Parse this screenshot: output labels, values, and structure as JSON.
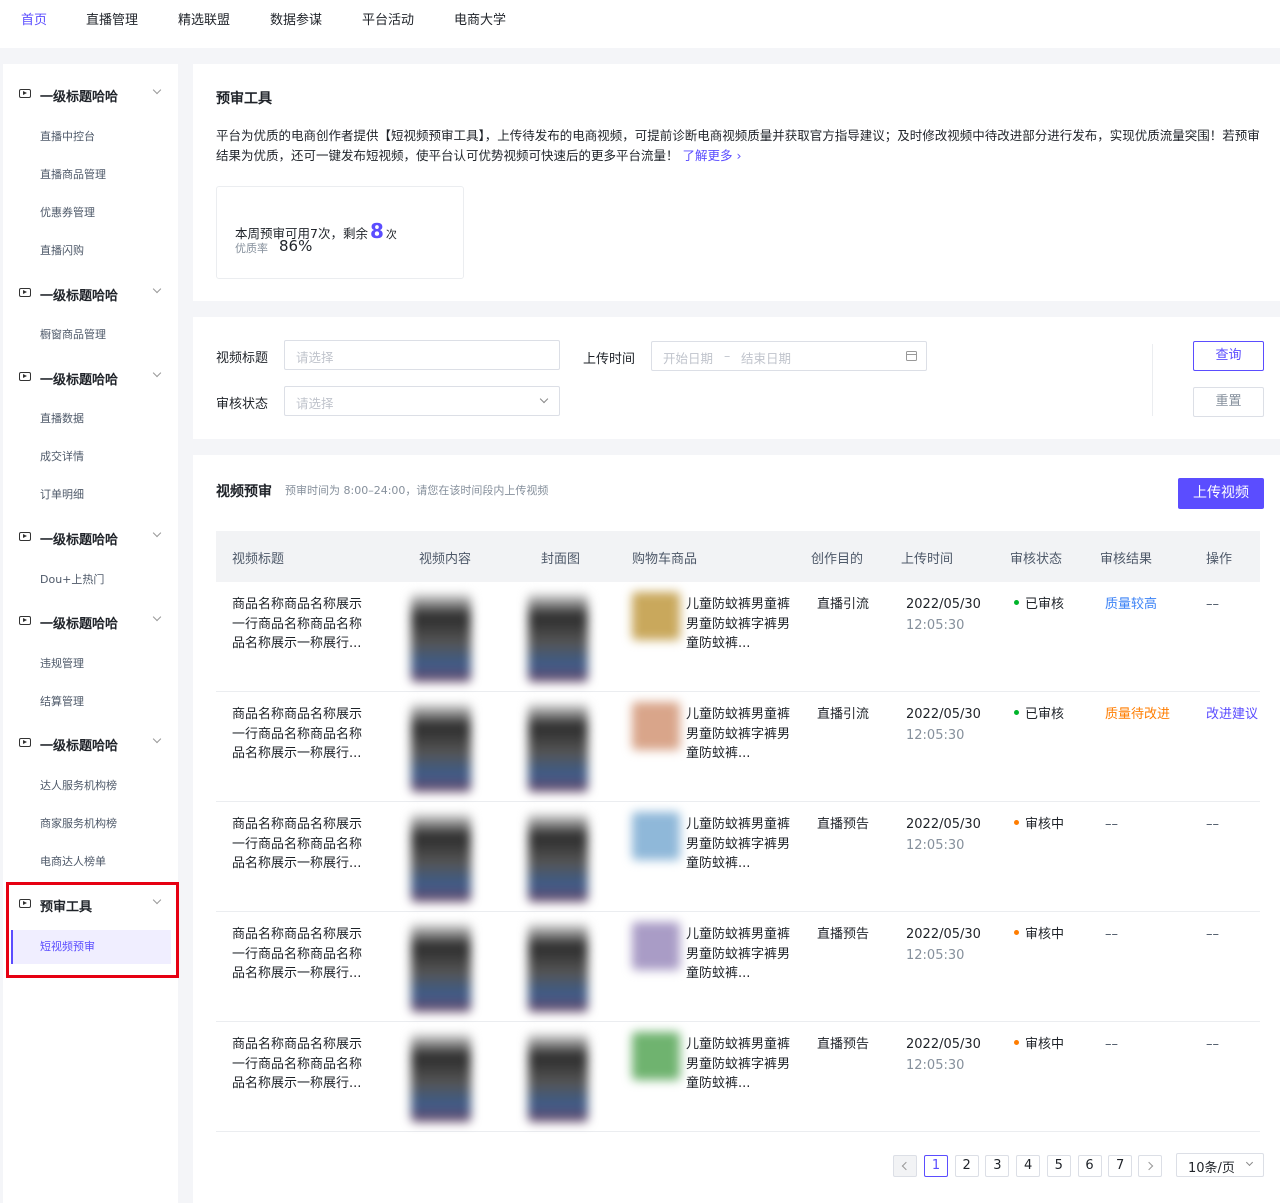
{
  "topnav": {
    "items": [
      "首页",
      "直播管理",
      "精选联盟",
      "数据参谋",
      "平台活动",
      "电商大学"
    ],
    "active_index": 0
  },
  "sidebar": {
    "groups": [
      {
        "label": "一级标题哈哈",
        "items": [
          "直播中控台",
          "直播商品管理",
          "优惠券管理",
          "直播闪购"
        ]
      },
      {
        "label": "一级标题哈哈",
        "items": [
          "橱窗商品管理"
        ]
      },
      {
        "label": "一级标题哈哈",
        "items": [
          "直播数据",
          "成交详情",
          "订单明细"
        ]
      },
      {
        "label": "一级标题哈哈",
        "items": [
          "Dou+上热门"
        ]
      },
      {
        "label": "一级标题哈哈",
        "items": [
          "违规管理",
          "结算管理"
        ]
      },
      {
        "label": "一级标题哈哈",
        "items": [
          "达人服务机构榜",
          "商家服务机构榜",
          "电商达人榜单"
        ]
      },
      {
        "label": "预审工具",
        "items": [
          "短视频预审"
        ]
      }
    ],
    "active_item": "短视频预审"
  },
  "intro": {
    "title": "预审工具",
    "description": "平台为优质的电商创作者提供【短视频预审工具】，上传待发布的电商视频，可提前诊断电商视频质量并获取官方指导建议；及时修改视频中待改进部分进行发布，实现优质流量突围！若预审结果为优质，还可一键发布短视频，使平台认可优势视频可快速后的更多平台流量！",
    "learn_more": "了解更多 ›",
    "quota_prefix": "本周预审可用7次，剩余",
    "quota_remaining": "8",
    "quota_suffix": "次",
    "quality_label": "优质率",
    "quality_value": "86%"
  },
  "filters": {
    "title_label": "视频标题",
    "title_placeholder": "请选择",
    "upload_time_label": "上传时间",
    "date_start_placeholder": "开始日期",
    "date_sep": "–",
    "date_end_placeholder": "结束日期",
    "status_label": "审核状态",
    "status_placeholder": "请选择",
    "query_button": "查询",
    "reset_button": "重置"
  },
  "table_section": {
    "title": "视频预审",
    "hint": "预审时间为  8:00–24:00，请您在该时间段内上传视频",
    "upload_button": "上传视频",
    "columns": [
      "视频标题",
      "视频内容",
      "封面图",
      "购物车商品",
      "创作目的",
      "上传时间",
      "审核状态",
      "审核结果",
      "操作"
    ],
    "rows": [
      {
        "title": "商品名称商品名称展示一行商品名称商品名称品名称展示一称展行...",
        "product": "儿童防蚊裤男童裤男童防蚊裤字裤男童防蚊裤...",
        "purpose": "直播引流",
        "date": "2022/05/30",
        "time": "12:05:30",
        "status": "已审核",
        "status_color": "#00b42a",
        "result": "质量较高",
        "result_color": "#3b82f6",
        "op": "––",
        "thumb_color": "#c9a85c"
      },
      {
        "title": "商品名称商品名称展示一行商品名称商品名称品名称展示一称展行...",
        "product": "儿童防蚊裤男童裤男童防蚊裤字裤男童防蚊裤...",
        "purpose": "直播引流",
        "date": "2022/05/30",
        "time": "12:05:30",
        "status": "已审核",
        "status_color": "#00b42a",
        "result": "质量待改进",
        "result_color": "#ff7d00",
        "op": "改进建议",
        "thumb_color": "#d9a58a"
      },
      {
        "title": "商品名称商品名称展示一行商品名称商品名称品名称展示一称展行...",
        "product": "儿童防蚊裤男童裤男童防蚊裤字裤男童防蚊裤...",
        "purpose": "直播预告",
        "date": "2022/05/30",
        "time": "12:05:30",
        "status": "审核中",
        "status_color": "#ff7d00",
        "result": "––",
        "result_color": "#4e5969",
        "op": "––",
        "thumb_color": "#8fb8d9"
      },
      {
        "title": "商品名称商品名称展示一行商品名称商品名称品名称展示一称展行...",
        "product": "儿童防蚊裤男童裤男童防蚊裤字裤男童防蚊裤...",
        "purpose": "直播预告",
        "date": "2022/05/30",
        "time": "12:05:30",
        "status": "审核中",
        "status_color": "#ff7d00",
        "result": "––",
        "result_color": "#4e5969",
        "op": "––",
        "thumb_color": "#a99cc6"
      },
      {
        "title": "商品名称商品名称展示一行商品名称商品名称品名称展示一称展行...",
        "product": "儿童防蚊裤男童裤男童防蚊裤字裤男童防蚊裤...",
        "purpose": "直播预告",
        "date": "2022/05/30",
        "time": "12:05:30",
        "status": "审核中",
        "status_color": "#ff7d00",
        "result": "––",
        "result_color": "#4e5969",
        "op": "––",
        "thumb_color": "#6fb36f"
      }
    ]
  },
  "pagination": {
    "pages": [
      "1",
      "2",
      "3",
      "4",
      "5",
      "6",
      "7"
    ],
    "current": "1",
    "page_size": "10条/页"
  },
  "colors": {
    "accent": "#5b4dff",
    "success": "#00b42a",
    "warning": "#ff7d00",
    "highlight_box": "#e60012"
  }
}
